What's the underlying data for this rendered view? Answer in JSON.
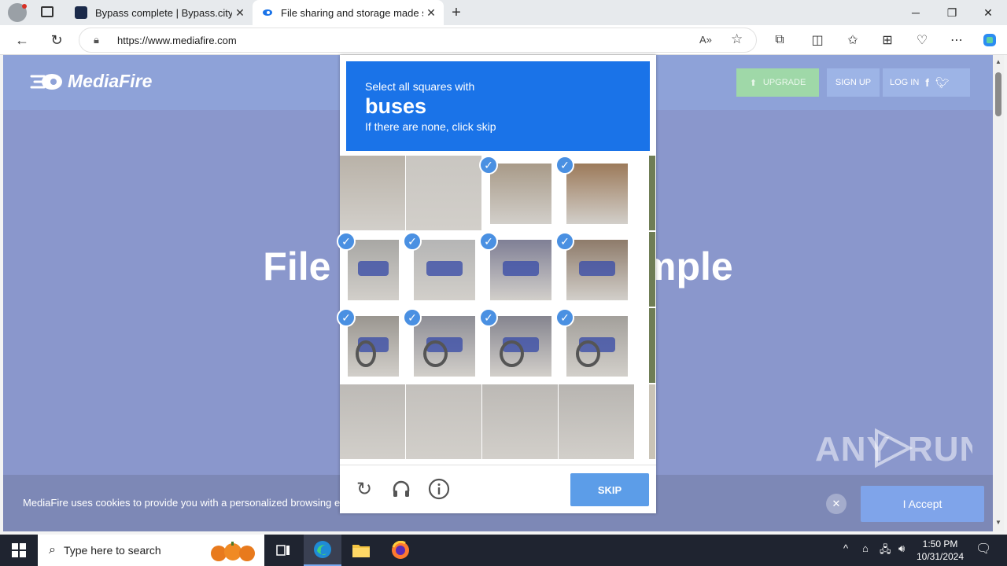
{
  "browser": {
    "tabs": [
      {
        "title": "Bypass complete | Bypass.city",
        "active": false,
        "favicon_color": "#1b2a4a"
      },
      {
        "title": "File sharing and storage made simple",
        "active": true,
        "favicon_color": "#1a73e8"
      }
    ],
    "new_tab_label": "+",
    "url": "https://www.mediafire.com"
  },
  "mediafire": {
    "logo_text": "MediaFire",
    "nav": {
      "upgrade": "UPGRADE",
      "signup": "SIGN UP",
      "login": "LOG IN"
    },
    "headline": "File storage made simple",
    "cookie_text": "MediaFire uses cookies to provide you with a personalized browsing experience. By using our website, you agree to our Cookie Policy.",
    "cookie_accept": "I Accept"
  },
  "captcha": {
    "instruction": "Select all squares with",
    "target": "buses",
    "hint": "If there are none, click skip",
    "skip_label": "SKIP",
    "selected": [
      [
        false,
        false,
        true,
        true
      ],
      [
        true,
        true,
        true,
        true
      ],
      [
        true,
        true,
        true,
        true
      ],
      [
        false,
        false,
        false,
        false
      ]
    ],
    "icons": [
      "reload-icon",
      "audio-icon",
      "info-icon"
    ]
  },
  "watermark": "ANY RUN",
  "taskbar": {
    "search_placeholder": "Type here to search",
    "time": "1:50 PM",
    "date": "10/31/2024"
  },
  "colors": {
    "captcha_blue": "#1a73e8",
    "mediafire_overlay": "#8a97cc",
    "taskbar": "#1f2430"
  }
}
